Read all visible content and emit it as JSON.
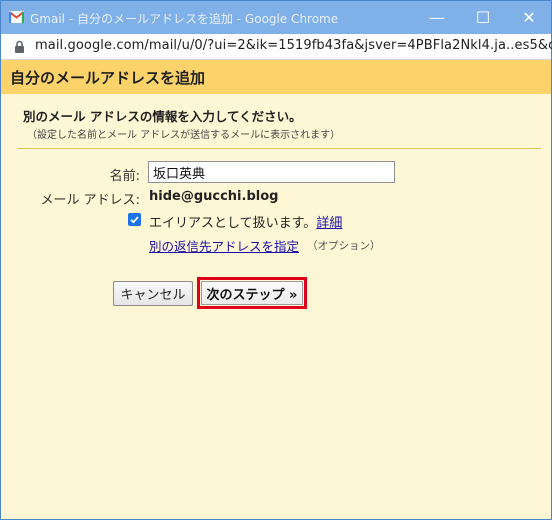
{
  "window": {
    "title": "Gmail - 自分のメールアドレスを追加 - Google Chrome",
    "controls": {
      "minimize": "—",
      "maximize": "☐",
      "close": "✕"
    }
  },
  "address_bar": {
    "url": "mail.google.com/mail/u/0/?ui=2&ik=1519fb43fa&jsver=4PBFla2Nkl4.ja..es5&c..."
  },
  "dialog": {
    "heading": "自分のメールアドレスを追加",
    "info_title": "別のメール アドレスの情報を入力してください。",
    "info_subtitle": "（設定した名前とメール アドレスが送信するメールに表示されます）",
    "name_label": "名前:",
    "name_value": "坂口英典",
    "email_label": "メール アドレス:",
    "email_value": "hide@gucchi.blog",
    "alias_checked": true,
    "alias_label": "エイリアスとして扱います。",
    "details_link": "詳細",
    "reply_to_link": "別の返信先アドレスを指定",
    "reply_to_optional": "（オプション）",
    "cancel_label": "キャンセル",
    "next_label": "次のステップ »",
    "highlight_color": "#e0001a"
  }
}
